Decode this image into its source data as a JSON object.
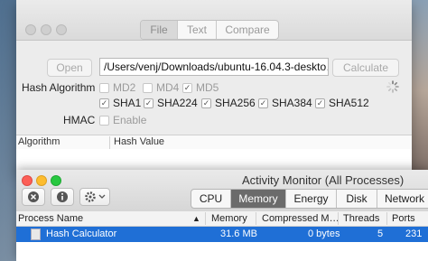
{
  "hash_calculator": {
    "tabs": [
      "File",
      "Text",
      "Compare"
    ],
    "active_tab": "File",
    "open_button": "Open",
    "file_path": "/Users/venj/Downloads/ubuntu-16.04.3-deskto…",
    "calculate_button": "Calculate",
    "hash_algorithm_label": "Hash Algorithm",
    "algorithms_row1": [
      {
        "label": "MD2",
        "checked": false,
        "enabled": false
      },
      {
        "label": "MD4",
        "checked": false,
        "enabled": false
      },
      {
        "label": "MD5",
        "checked": true,
        "enabled": false
      }
    ],
    "algorithms_row2": [
      {
        "label": "SHA1",
        "checked": true,
        "enabled": true
      },
      {
        "label": "SHA224",
        "checked": true,
        "enabled": true
      },
      {
        "label": "SHA256",
        "checked": true,
        "enabled": true
      },
      {
        "label": "SHA384",
        "checked": true,
        "enabled": true
      },
      {
        "label": "SHA512",
        "checked": true,
        "enabled": true
      }
    ],
    "hmac_label": "HMAC",
    "hmac_enable": "Enable",
    "table_headers": [
      "Algorithm",
      "Hash Value"
    ]
  },
  "activity_monitor": {
    "title": "Activity Monitor (All Processes)",
    "tabs": [
      "CPU",
      "Memory",
      "Energy",
      "Disk",
      "Network"
    ],
    "active_tab": "Memory",
    "columns": [
      "Process Name",
      "Memory",
      "Compressed M…",
      "Threads",
      "Ports"
    ],
    "rows": [
      {
        "process": "Hash Calculator",
        "memory": "31.6 MB",
        "compressed": "0 bytes",
        "threads": "5",
        "ports": "231"
      }
    ]
  }
}
